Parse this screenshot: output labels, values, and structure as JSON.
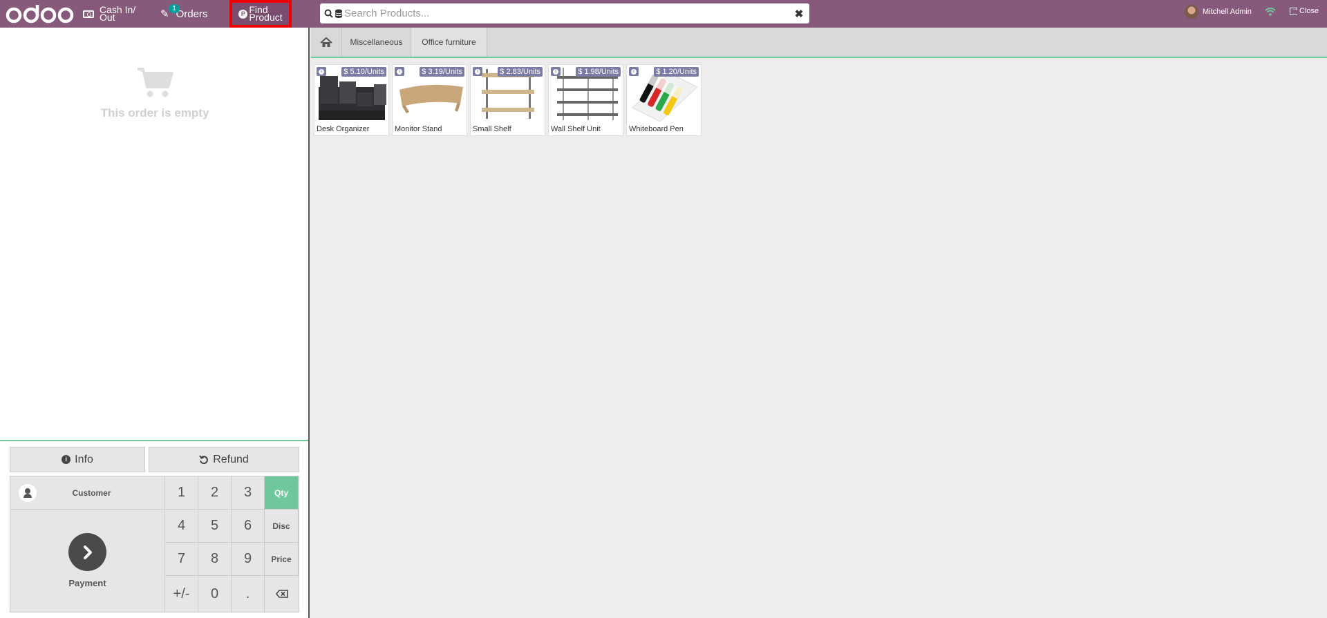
{
  "header": {
    "cash_label_1": "Cash In/",
    "cash_label_2": "Out",
    "orders_label": "Orders",
    "orders_badge": "1",
    "find_label_1": "Find",
    "find_label_2": "Product",
    "search_placeholder": "Search Products...",
    "user_name": "Mitchell Admin",
    "close_label": "Close",
    "brand_color": "#875a7b"
  },
  "order": {
    "empty_text": "This order is empty"
  },
  "controls": {
    "info_label": "Info",
    "refund_label": "Refund",
    "customer_label": "Customer",
    "payment_label": "Payment",
    "keys": [
      "1",
      "2",
      "3",
      "4",
      "5",
      "6",
      "7",
      "8",
      "9",
      "+/-",
      "0",
      "."
    ],
    "modes": [
      "Qty",
      "Disc",
      "Price"
    ],
    "active_mode": "Qty"
  },
  "categories": {
    "items": [
      "Miscellaneous",
      "Office furniture"
    ]
  },
  "products": [
    {
      "name": "Desk Organizer",
      "price": "$ 5.10/Units"
    },
    {
      "name": "Monitor Stand",
      "price": "$ 3.19/Units"
    },
    {
      "name": "Small Shelf",
      "price": "$ 2.83/Units"
    },
    {
      "name": "Wall Shelf Unit",
      "price": "$ 1.98/Units"
    },
    {
      "name": "Whiteboard Pen",
      "price": "$ 1.20/Units"
    }
  ]
}
